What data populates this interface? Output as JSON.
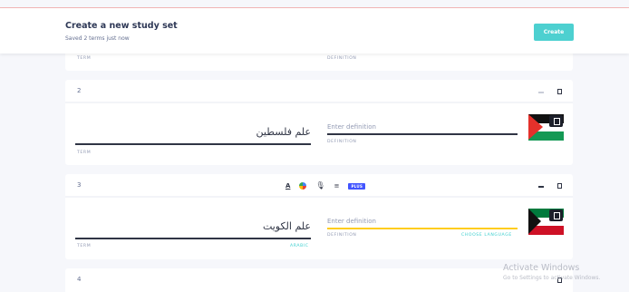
{
  "header": {
    "title": "Create a new study set",
    "subtitle": "Saved 2 terms just now",
    "create_label": "Create"
  },
  "cards": [
    {
      "term_label": "TERM",
      "definition_label": "DEFINITION"
    },
    {
      "number": "2",
      "term": "علم فلسطين",
      "definition_placeholder": "Enter definition",
      "term_label": "TERM",
      "definition_label": "DEFINITION"
    },
    {
      "number": "3",
      "term": "علم الكويت",
      "definition_placeholder": "Enter definition",
      "term_label": "TERM",
      "language_label": "ARABIC",
      "definition_label": "DEFINITION",
      "choose_language_label": "CHOOSE LANGUAGE",
      "toolbar": {
        "format_glyph": "A",
        "plus_badge": "PLUS"
      }
    },
    {
      "number": "4"
    }
  ],
  "icons": {
    "trash": "trash-icon",
    "reorder": "drag-handle-icon",
    "mic": "microphone-icon",
    "text_format": "text-format-icon",
    "color": "color-picker-icon",
    "list_add": "list-add-icon"
  },
  "colors": {
    "accent": "#4dd0d0",
    "focus_underline": "#ffcd1f",
    "plus_badge": "#4255ff"
  },
  "watermark": {
    "line1": "Activate Windows",
    "line2": "Go to Settings to activate Windows."
  }
}
